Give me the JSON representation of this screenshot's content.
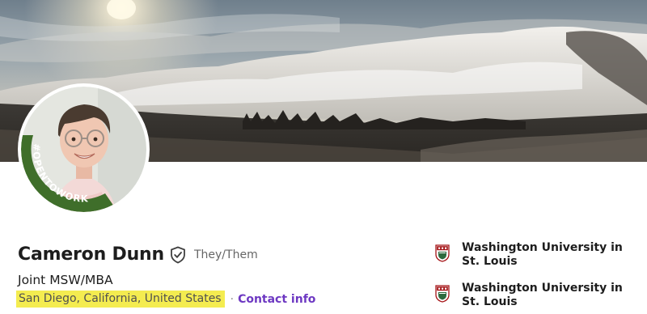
{
  "profile": {
    "name": "Cameron Dunn",
    "pronouns": "They/Them",
    "headline": "Joint MSW/MBA",
    "location": "San Diego, California, United States",
    "separator": "·",
    "contact_label": "Contact info",
    "open_to_work_badge": "#OPENTOWORK"
  },
  "education": [
    {
      "school": "Washington University in St. Louis",
      "logo": "washu-shield-icon"
    },
    {
      "school": "Washington University in St. Louis",
      "logo": "washu-shield-icon"
    }
  ],
  "colors": {
    "open_to_work_ring": "#3f6e2a",
    "contact_link": "#6d38c2",
    "location_highlight": "#f4ec50",
    "washu_red": "#a51417"
  }
}
